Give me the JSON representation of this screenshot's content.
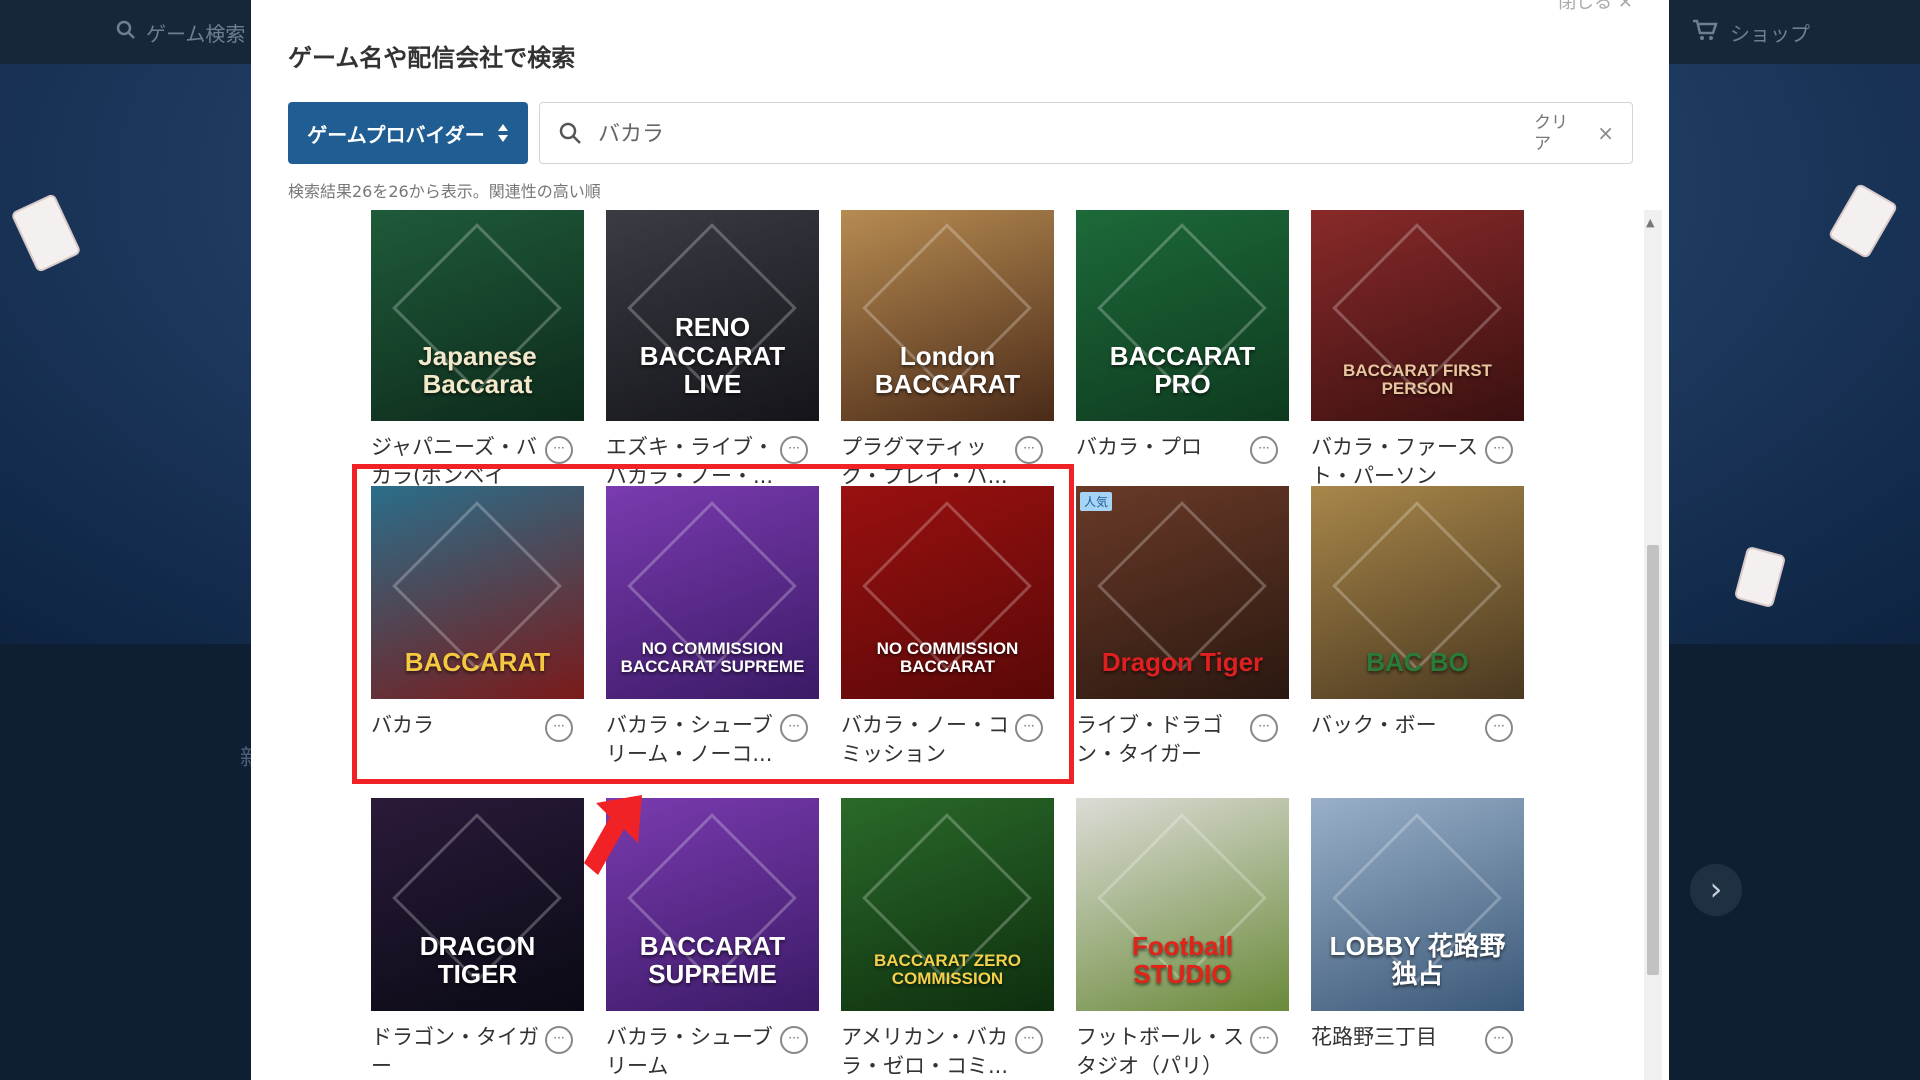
{
  "background": {
    "search_label": "ゲーム検索",
    "shop_label": "ショップ",
    "next_label": "›",
    "side_char": "新"
  },
  "modal": {
    "close_label": "閉じる ✕",
    "title": "ゲーム名や配信会社で検索",
    "provider_button": "ゲームプロバイダー",
    "search": {
      "value": "バカラ",
      "clear_label": "クリア",
      "clear_icon": "×"
    },
    "result_info": "検索結果26を26から表示。関連性の高い順",
    "more_icon": "···"
  },
  "games": [
    {
      "label": "ジャパニーズ・バカラ(ボンベイク...",
      "art": "Japanese Baccarat",
      "bg1": "#1f5b3a",
      "bg2": "#0d2a1b",
      "fg": "#f3e8c9"
    },
    {
      "label": "エズキ・ライブ・バカラ・ノー・...",
      "art": "RENO BACCARAT LIVE",
      "bg1": "#3b3c44",
      "bg2": "#14141a",
      "fg": "#ffffff"
    },
    {
      "label": "プラグマティック・プレイ・バ...",
      "art": "London BACCARAT",
      "bg1": "#b88c52",
      "bg2": "#4a2a18",
      "fg": "#ffffff"
    },
    {
      "label": "バカラ・プロ",
      "art": "BACCARAT PRO",
      "bg1": "#1d6a3a",
      "bg2": "#0e3a1f",
      "fg": "#ffffff"
    },
    {
      "label": "バカラ・ファースト・パーソン",
      "art": "BACCARAT FIRST PERSON",
      "bg1": "#8a2a2a",
      "bg2": "#3a1010",
      "fg": "#e8c7a0"
    },
    {
      "label": "バカラ",
      "art": "BACCARAT",
      "bg1": "#2a6e8a",
      "bg2": "#7a1a1a",
      "fg": "#f5c842"
    },
    {
      "label": "バカラ・シューブリーム・ノーコ...",
      "art": "NO COMMISSION BACCARAT SUPREME",
      "bg1": "#7a3bb0",
      "bg2": "#3b1a66",
      "fg": "#ffffff"
    },
    {
      "label": "バカラ・ノー・コミッション",
      "art": "NO COMMISSION BACCARAT",
      "bg1": "#9a1010",
      "bg2": "#5a0808",
      "fg": "#ffffff"
    },
    {
      "label": "ライブ・ドラゴン・タイガー",
      "art": "Dragon Tiger",
      "bg1": "#6a3a28",
      "bg2": "#2a1810",
      "fg": "#e02020",
      "badge": "人気"
    },
    {
      "label": "バック・ボー",
      "art": "BAC BO",
      "bg1": "#a8874a",
      "bg2": "#4a3820",
      "fg": "#2a7a3a"
    },
    {
      "label": "ドラゴン・タイガー",
      "art": "DRAGON TIGER",
      "bg1": "#2a1a3a",
      "bg2": "#0a0a14",
      "fg": "#ffffff"
    },
    {
      "label": "バカラ・シューブリーム",
      "art": "BACCARAT SUPREME",
      "bg1": "#7a3bb0",
      "bg2": "#3b1a66",
      "fg": "#ffffff"
    },
    {
      "label": "アメリカン・バカラ・ゼロ・コミ...",
      "art": "BACCARAT ZERO COMMISSION",
      "bg1": "#2a6a2a",
      "bg2": "#0e2e0e",
      "fg": "#f5d04a"
    },
    {
      "label": "フットボール・スタジオ（パリ）",
      "art": "Football STUDIO",
      "bg1": "#dcdcd6",
      "bg2": "#6a8a3a",
      "fg": "#e0241a"
    },
    {
      "label": "花路野三丁目",
      "art": "LOBBY 花路野 独占",
      "bg1": "#9ab0c8",
      "bg2": "#3a5878",
      "fg": "#ffffff"
    }
  ]
}
